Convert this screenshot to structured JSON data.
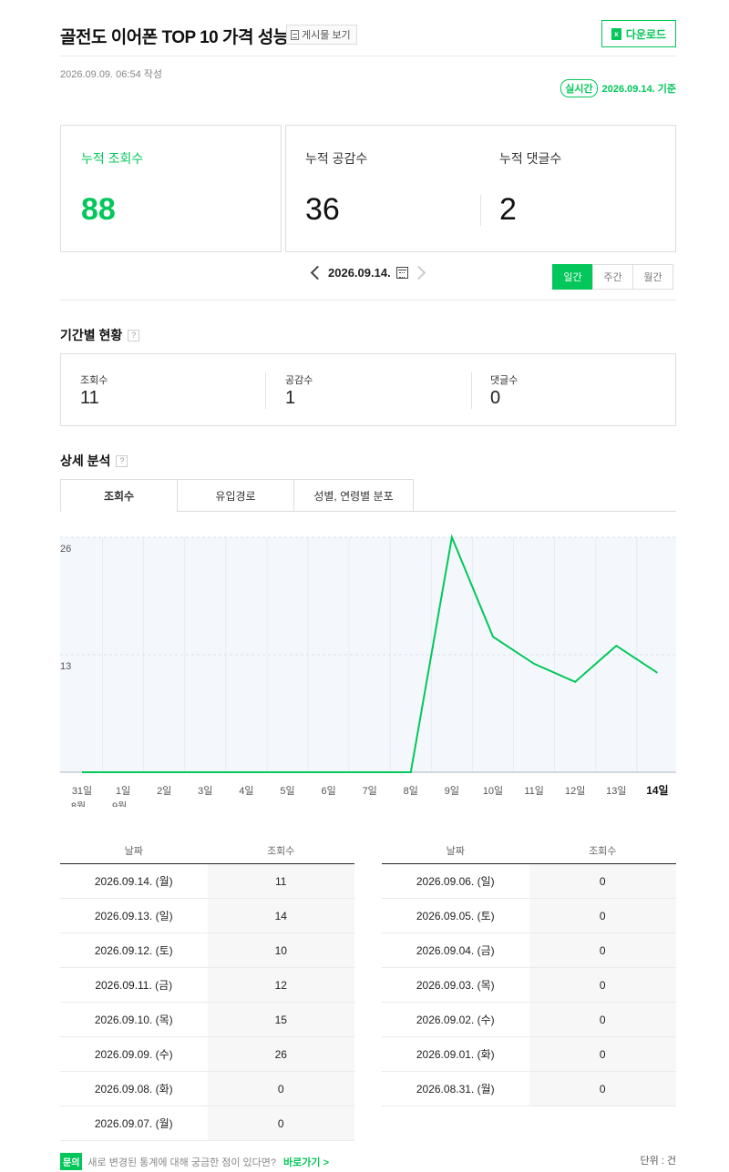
{
  "header": {
    "title": "골전도 이어폰 TOP 10 가격 성능",
    "post_link_label": "게시물 보기",
    "download_label": "다운로드",
    "written": "2026.09.09. 06:54 작성",
    "realtime_badge": "실시간",
    "realtime_date": "2026.09.14. 기준"
  },
  "summary": {
    "views_label": "누적 조회수",
    "views_value": "88",
    "likes_label": "누적 공감수",
    "likes_value": "36",
    "comments_label": "누적 댓글수",
    "comments_value": "2"
  },
  "date_nav": {
    "date": "2026.09.14.",
    "tabs": [
      "일간",
      "주간",
      "월간"
    ],
    "active_tab": "일간"
  },
  "period_section": {
    "title": "기간별 현황",
    "items": [
      {
        "label": "조회수",
        "value": "11"
      },
      {
        "label": "공감수",
        "value": "1"
      },
      {
        "label": "댓글수",
        "value": "0"
      }
    ]
  },
  "detail_section": {
    "title": "상세 분석",
    "tabs": [
      "조회수",
      "유입경로",
      "성별, 연령별 분포"
    ],
    "active_tab": "조회수"
  },
  "chart_data": {
    "type": "line",
    "categories": [
      "31일",
      "1일",
      "2일",
      "3일",
      "4일",
      "5일",
      "6일",
      "7일",
      "8일",
      "9일",
      "10일",
      "11일",
      "12일",
      "13일",
      "14일"
    ],
    "month_labels": [
      "8월",
      "9월"
    ],
    "values": [
      0,
      0,
      0,
      0,
      0,
      0,
      0,
      0,
      0,
      26,
      15,
      12,
      10,
      14,
      11
    ],
    "y_ticks": [
      26,
      13
    ],
    "ylim": [
      0,
      26
    ],
    "color": "#03c75a",
    "grid": true
  },
  "table": {
    "headers": [
      "날짜",
      "조회수"
    ],
    "left": [
      {
        "date": "2026.09.14. (월)",
        "value": "11"
      },
      {
        "date": "2026.09.13. (일)",
        "value": "14"
      },
      {
        "date": "2026.09.12. (토)",
        "value": "10"
      },
      {
        "date": "2026.09.11. (금)",
        "value": "12"
      },
      {
        "date": "2026.09.10. (목)",
        "value": "15"
      },
      {
        "date": "2026.09.09. (수)",
        "value": "26"
      },
      {
        "date": "2026.09.08. (화)",
        "value": "0"
      },
      {
        "date": "2026.09.07. (월)",
        "value": "0"
      }
    ],
    "right": [
      {
        "date": "2026.09.06. (일)",
        "value": "0"
      },
      {
        "date": "2026.09.05. (토)",
        "value": "0"
      },
      {
        "date": "2026.09.04. (금)",
        "value": "0"
      },
      {
        "date": "2026.09.03. (목)",
        "value": "0"
      },
      {
        "date": "2026.09.02. (수)",
        "value": "0"
      },
      {
        "date": "2026.09.01. (화)",
        "value": "0"
      },
      {
        "date": "2026.08.31. (월)",
        "value": "0"
      }
    ]
  },
  "footer": {
    "badge": "문의",
    "text": "새로 변경된 통계에 대해 궁금한 점이 있다면?",
    "link": "바로가기 >",
    "unit": "단위 : 건"
  },
  "icons": {
    "post": "document-icon",
    "download": "excel-icon",
    "calendar": "calendar-icon",
    "help": "help-icon",
    "prev": "chevron-left-icon",
    "next": "chevron-right-icon"
  }
}
